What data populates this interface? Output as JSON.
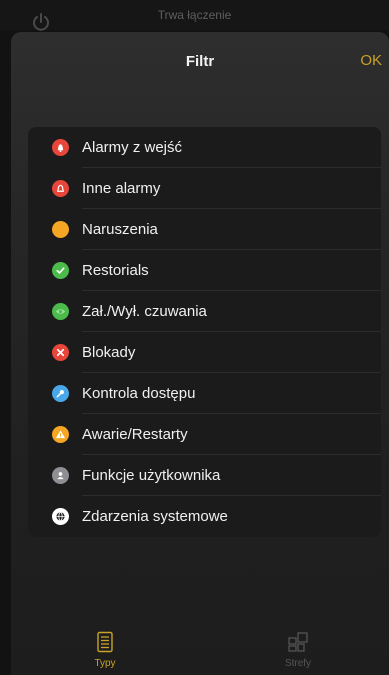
{
  "background_app": {
    "status_text": "Trwa łączenie",
    "power_icon": "power-icon"
  },
  "sheet": {
    "title": "Filtr",
    "ok_label": "OK"
  },
  "filter_items": [
    {
      "label": "Alarmy z wejść",
      "icon": "alarm-bell-icon",
      "color": "#e8463a"
    },
    {
      "label": "Inne alarmy",
      "icon": "alarm-bell-outline-icon",
      "color": "#e8463a"
    },
    {
      "label": "Naruszenia",
      "icon": "violation-dot-icon",
      "color": "#f5a623"
    },
    {
      "label": "Restorials",
      "icon": "checkmark-icon",
      "color": "#4cbb4b"
    },
    {
      "label": "Zał./Wył. czuwania",
      "icon": "eye-icon",
      "color": "#4cbb4b"
    },
    {
      "label": "Blokady",
      "icon": "x-mark-icon",
      "color": "#e8463a"
    },
    {
      "label": "Kontrola dostępu",
      "icon": "key-icon",
      "color": "#4aa8e8"
    },
    {
      "label": "Awarie/Restarty",
      "icon": "warning-triangle-icon",
      "color": "#f5a623"
    },
    {
      "label": "Funkcje użytkownika",
      "icon": "user-icon",
      "color": "#8e8e93"
    },
    {
      "label": "Zdarzenia systemowe",
      "icon": "globe-icon",
      "color": "#ffffff"
    }
  ],
  "tabs": [
    {
      "label": "Typy",
      "icon": "list-document-icon",
      "active": true
    },
    {
      "label": "Strefy",
      "icon": "zones-grid-icon",
      "active": false
    }
  ],
  "colors": {
    "accent": "#c9a227",
    "panel": "#1b1b1b"
  }
}
